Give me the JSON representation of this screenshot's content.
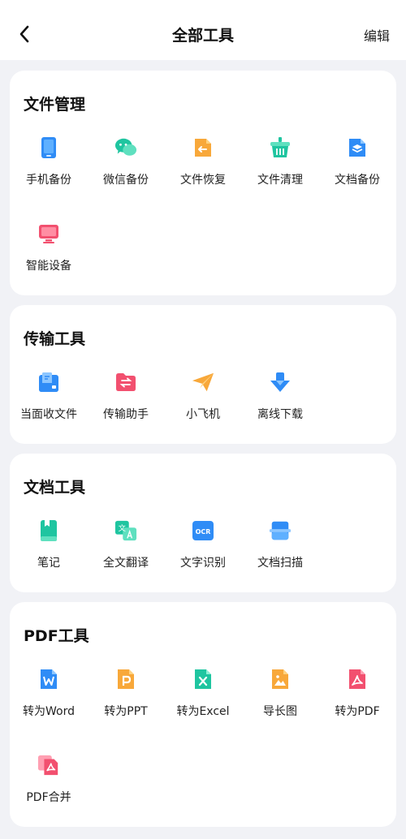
{
  "header": {
    "title": "全部工具",
    "edit_label": "编辑"
  },
  "sections": [
    {
      "title": "文件管理",
      "items": [
        {
          "label": "手机备份",
          "icon": "phone-icon"
        },
        {
          "label": "微信备份",
          "icon": "wechat-icon"
        },
        {
          "label": "文件恢复",
          "icon": "file-restore-icon"
        },
        {
          "label": "文件清理",
          "icon": "clean-basket-icon"
        },
        {
          "label": "文档备份",
          "icon": "doc-backup-icon"
        },
        {
          "label": "智能设备",
          "icon": "smart-device-icon"
        }
      ]
    },
    {
      "title": "传输工具",
      "items": [
        {
          "label": "当面收文件",
          "icon": "receive-file-icon"
        },
        {
          "label": "传输助手",
          "icon": "transfer-folder-icon"
        },
        {
          "label": "小飞机",
          "icon": "paper-plane-icon"
        },
        {
          "label": "离线下载",
          "icon": "download-icon"
        }
      ]
    },
    {
      "title": "文档工具",
      "items": [
        {
          "label": "笔记",
          "icon": "note-icon"
        },
        {
          "label": "全文翻译",
          "icon": "translate-icon"
        },
        {
          "label": "文字识别",
          "icon": "ocr-icon"
        },
        {
          "label": "文档扫描",
          "icon": "scan-icon"
        }
      ]
    },
    {
      "title": "PDF工具",
      "items": [
        {
          "label": "转为Word",
          "icon": "word-icon"
        },
        {
          "label": "转为PPT",
          "icon": "ppt-icon"
        },
        {
          "label": "转为Excel",
          "icon": "excel-icon"
        },
        {
          "label": "导长图",
          "icon": "long-image-icon"
        },
        {
          "label": "转为PDF",
          "icon": "pdf-icon"
        },
        {
          "label": "PDF合并",
          "icon": "pdf-merge-icon"
        }
      ]
    }
  ],
  "icon_glyphs": {
    "ocr": "OCR",
    "translate": "文"
  },
  "colors": {
    "blue": "#2f8cf6",
    "green": "#1fc5a0",
    "orange": "#f8a83a",
    "red": "#f2506f",
    "background": "#f1f2f6"
  }
}
